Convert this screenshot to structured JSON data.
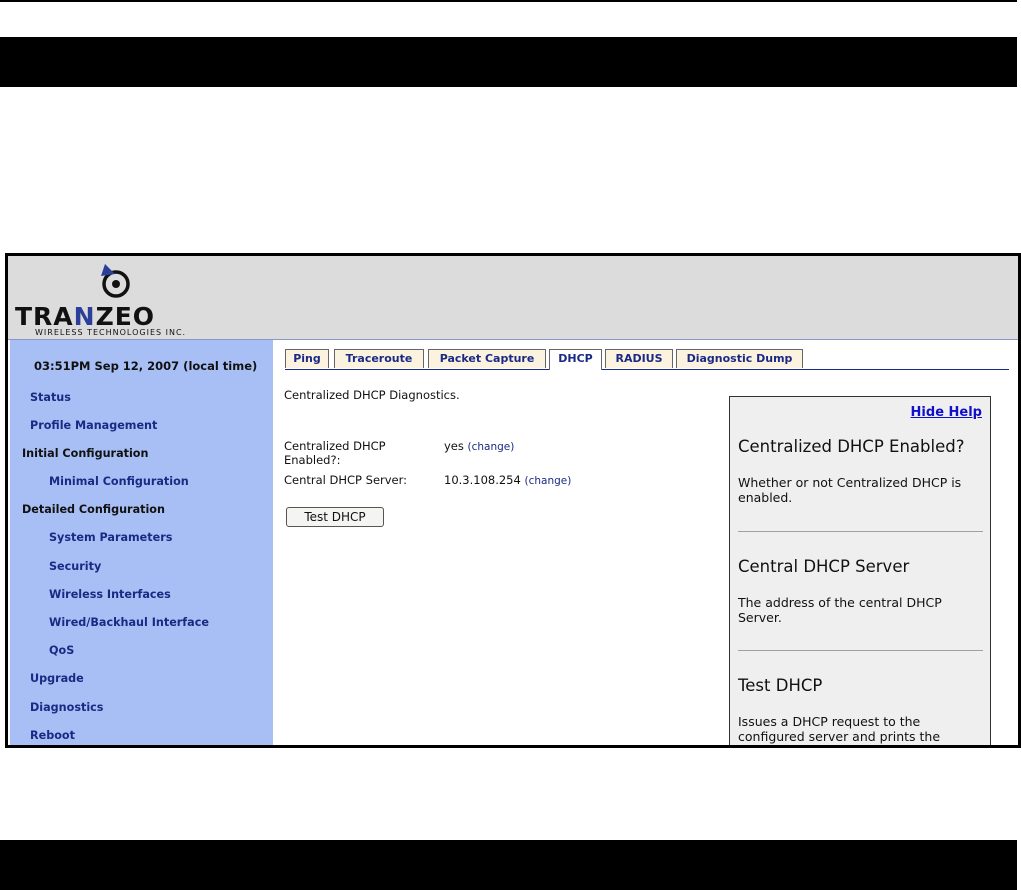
{
  "brand": {
    "word_pre": "TRA",
    "word_hl": "N",
    "word_post": "ZEO",
    "subtitle": "WIRELESS TECHNOLOGIES INC."
  },
  "sidebar": {
    "clock": "03:51PM Sep 12, 2007 (local time)",
    "items": [
      {
        "label": "Status"
      },
      {
        "label": "Profile Management"
      },
      {
        "label": "Initial Configuration"
      },
      {
        "label": "Minimal Configuration"
      },
      {
        "label": "Detailed Configuration"
      },
      {
        "label": "System Parameters"
      },
      {
        "label": "Security"
      },
      {
        "label": "Wireless Interfaces"
      },
      {
        "label": "Wired/Backhaul Interface"
      },
      {
        "label": "QoS"
      },
      {
        "label": "Upgrade"
      },
      {
        "label": "Diagnostics"
      },
      {
        "label": "Reboot"
      }
    ]
  },
  "tabs": [
    {
      "label": "Ping"
    },
    {
      "label": "Traceroute"
    },
    {
      "label": "Packet Capture"
    },
    {
      "label": "DHCP"
    },
    {
      "label": "RADIUS"
    },
    {
      "label": "Diagnostic Dump"
    }
  ],
  "main": {
    "title": "Centralized DHCP Diagnostics.",
    "fields": [
      {
        "label_l1": "Centralized DHCP",
        "label_l2": "Enabled?:",
        "value": "yes",
        "change": "(change)"
      },
      {
        "label": "Central DHCP Server:",
        "value": "10.3.108.254",
        "change": "(change)"
      }
    ],
    "button": "Test DHCP"
  },
  "help": {
    "hide": "Hide Help",
    "sections": [
      {
        "heading": "Centralized DHCP Enabled?",
        "text": "Whether or not Centralized DHCP is enabled."
      },
      {
        "heading": "Central DHCP Server",
        "text": "The address of the central DHCP Server."
      },
      {
        "heading": "Test DHCP",
        "text": "Issues a DHCP request to the configured server and prints the"
      }
    ]
  }
}
